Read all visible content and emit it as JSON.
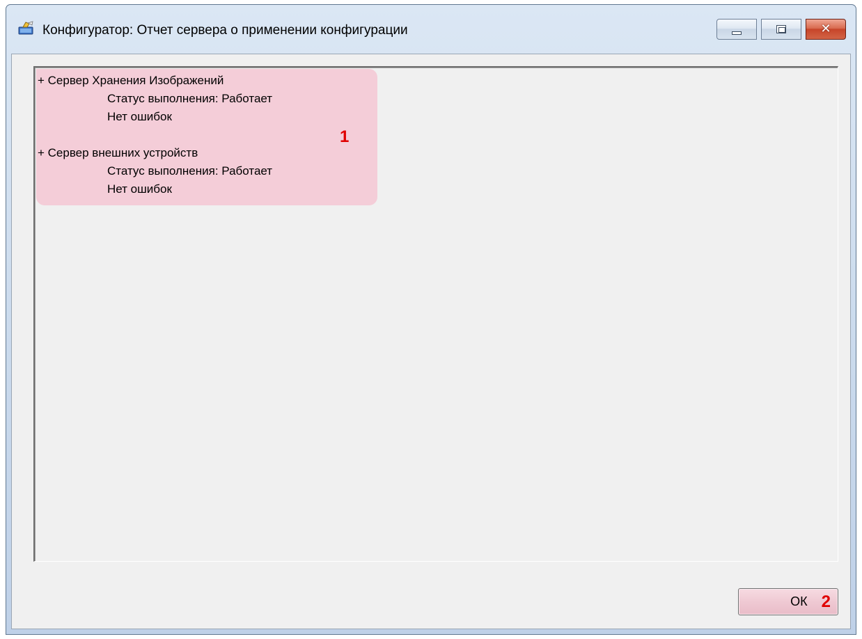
{
  "window": {
    "title": "Конфигуратор: Отчет сервера о применении конфигурации",
    "icon": "configurator-app-icon"
  },
  "caption_buttons": {
    "minimize_icon": "minimize-icon",
    "maximize_icon": "maximize-icon",
    "close_icon": "close-icon",
    "close_glyph": "✕"
  },
  "report": {
    "entries": [
      {
        "server": "+ Сервер Хранения Изображений",
        "status": "Статус выполнения: Работает",
        "errors": "Нет ошибок"
      },
      {
        "server": "+ Сервер внешних устройств",
        "status": "Статус выполнения: Работает",
        "errors": "Нет ошибок"
      }
    ],
    "highlight_color": "#f4cdd8"
  },
  "annotations": {
    "marker_1": "1",
    "marker_2": "2",
    "marker_color": "#e00000"
  },
  "buttons": {
    "ok_label": "ОК"
  }
}
